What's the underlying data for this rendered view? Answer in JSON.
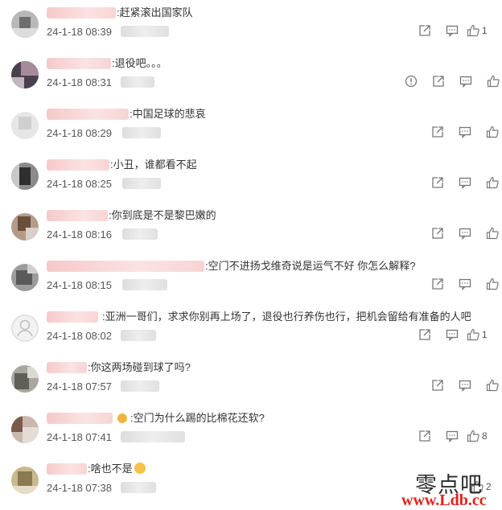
{
  "comments": [
    {
      "text": ":赶紧滚出国家队",
      "time": "24-1-18 08:39",
      "likes": "1",
      "has_report": false
    },
    {
      "text": ":退役吧。。。",
      "time": "24-1-18 08:31",
      "likes": "",
      "has_report": true
    },
    {
      "text": ":中国足球的悲哀",
      "time": "24-1-18 08:29",
      "likes": "",
      "has_report": false
    },
    {
      "text": ":小丑，谁都看不起",
      "time": "24-1-18 08:25",
      "likes": "",
      "has_report": false
    },
    {
      "text": ":你到底是不是黎巴嫩的",
      "time": "24-1-18 08:16",
      "likes": "",
      "has_report": false
    },
    {
      "text": ":空门不进扬戈维奇说是运气不好 你怎么解释?",
      "time": "24-1-18 08:15",
      "likes": "",
      "has_report": false
    },
    {
      "text": ":亚洲一哥们，求求你别再上场了，退役也行养伤也行，把机会留给有准备的人吧",
      "time": "24-1-18 08:02",
      "likes": "1",
      "has_report": false
    },
    {
      "text": ":你这两场碰到球了吗?",
      "time": "24-1-18 07:57",
      "likes": "",
      "has_report": false
    },
    {
      "text": ":空门为什么踢的比棉花还软?",
      "time": "24-1-18 07:41",
      "likes": "8",
      "has_report": false
    },
    {
      "text": ":啥也不是",
      "time": "24-1-18 07:38",
      "likes": "2",
      "has_report": false
    }
  ],
  "watermark": {
    "line1": "零点吧",
    "line2": "www.Ldb.cc"
  }
}
